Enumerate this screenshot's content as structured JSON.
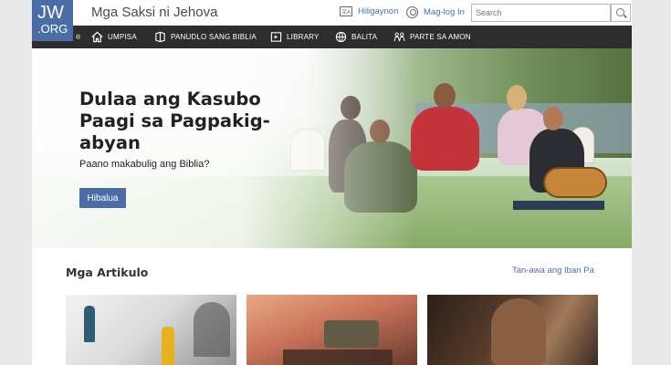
{
  "brand": {
    "logo_line1": "JW",
    "logo_line2": ".ORG",
    "registered": "®",
    "site_title": "Mga Saksi ni Jehova"
  },
  "header": {
    "language_label": "Hiligaynon",
    "language_icon_text": "文A",
    "login_label": "Mag-log In",
    "search_placeholder": "Search"
  },
  "nav": {
    "items": [
      {
        "label": "UMPISA",
        "icon": "home-icon"
      },
      {
        "label": "PANUDLO SANG BIBLIA",
        "icon": "bible-icon"
      },
      {
        "label": "LIBRARY",
        "icon": "library-icon"
      },
      {
        "label": "BALITA",
        "icon": "globe-icon"
      },
      {
        "label": "PARTE SA AMON",
        "icon": "people-icon"
      }
    ]
  },
  "hero": {
    "title": "Dulaa ang Kasubo Paagi sa Pagpakig-abyan",
    "subtitle": "Paano makabulig ang Biblia?",
    "button_label": "Hibalua"
  },
  "articles": {
    "heading": "Mga Artikulo",
    "see_more": "Tan-awa ang Iban Pa"
  },
  "colors": {
    "accent": "#4a6da7",
    "nav_bg": "#2d2d2d",
    "page_bg": "#e9e9ea"
  }
}
